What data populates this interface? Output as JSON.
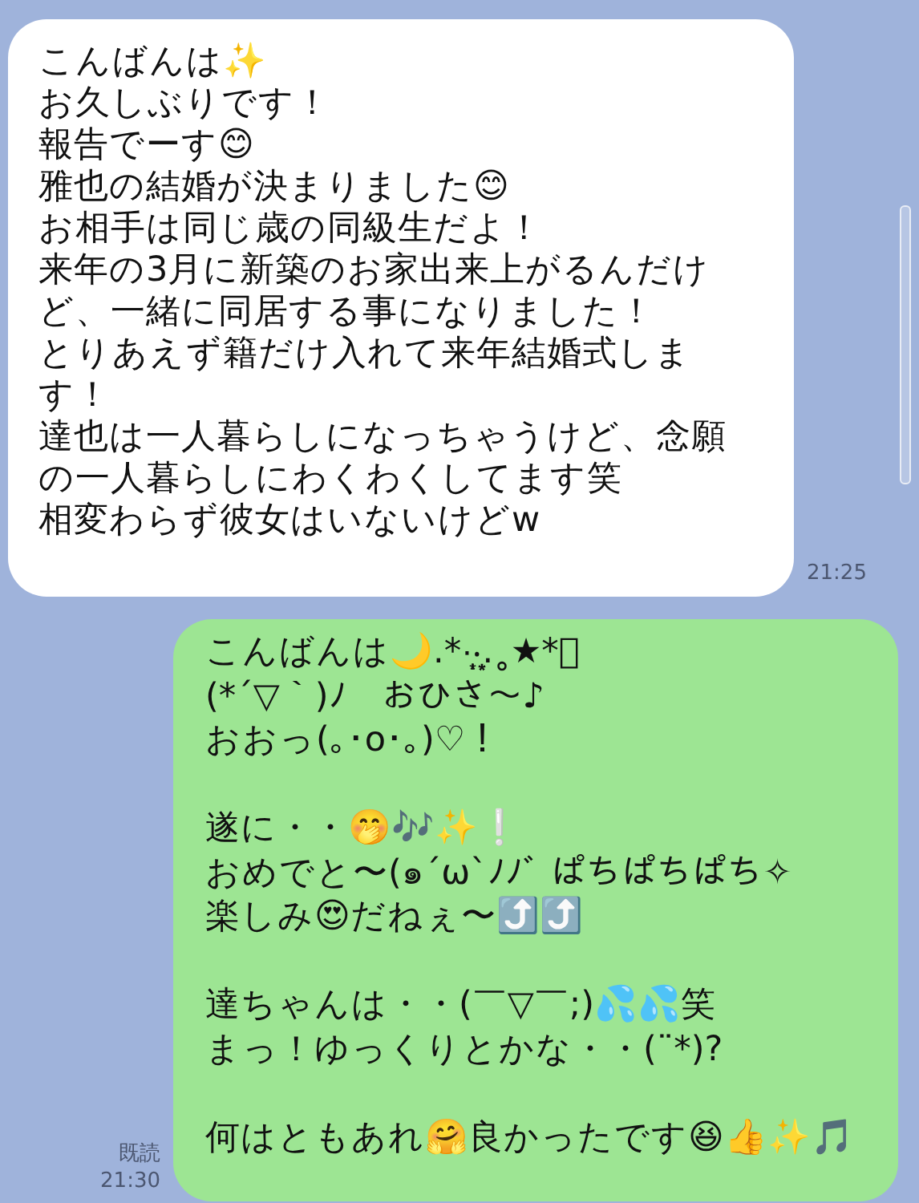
{
  "messages": [
    {
      "kind": "incoming",
      "time": "21:25",
      "paragraphs": [
        [
          "こんばんは✨",
          "お久しぶりです！",
          "報告でーす😊",
          "雅也の結婚が決まりました😊",
          "お相手は同じ歳の同級生だよ！",
          "来年の3月に新築のお家出来上がるんだけ",
          "ど、一緒に同居する事になりました！",
          "とりあえず籍だけ入れて来年結婚式しま",
          "す！",
          "達也は一人暮らしになっちゃうけど、念願",
          "の一人暮らしにわくわくしてます笑",
          "相変わらず彼女はいないけどw"
        ]
      ]
    },
    {
      "kind": "outgoing",
      "read_label": "既読",
      "time": "21:30",
      "paragraphs": [
        [
          "こんばんは🌙.*·̩͙‧͙.˳★*ﾟ",
          "(*´▽｀)ﾉ　おひさ〜♪",
          "おおっ(｡･o･｡)♡！"
        ],
        [
          "遂に・・🤭🎶✨❕",
          "おめでと〜(๑´ω`ﾉﾉﾞ ぱちぱちぱち✧",
          "楽しみ😍だねぇ〜⤴️⤴️"
        ],
        [
          "達ちゃんは・・(￣▽￣;)💦💦笑",
          "まっ！ゆっくりとかな・・(¨*)?"
        ],
        [
          "何はともあれ🤗良かったです😆👍✨🎵"
        ]
      ]
    }
  ]
}
